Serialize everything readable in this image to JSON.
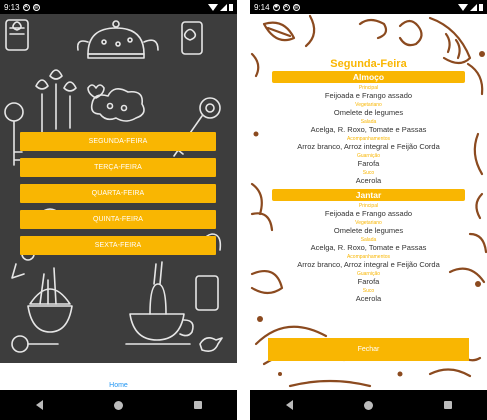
{
  "left_screen": {
    "status": {
      "time": "9:13",
      "icons": [
        "a-icon",
        "sync-icon"
      ]
    },
    "days": [
      "SEGUNDA-FEIRA",
      "TERÇA-FEIRA",
      "QUARTA-FEIRA",
      "QUINTA-FEIRA",
      "SEXTA-FEIRA"
    ],
    "bottom_tab": "Home"
  },
  "right_screen": {
    "status": {
      "time": "9:14"
    },
    "day_title": "Segunda-Feira",
    "lunch": {
      "title": "Almoço",
      "items": [
        {
          "label": "Principal",
          "value": "Feijoada e Frango assado"
        },
        {
          "label": "Vegetariano",
          "value": "Omelete de legumes"
        },
        {
          "label": "Salada",
          "value": "Acelga, R. Roxo, Tomate e Passas"
        },
        {
          "label": "Acompanhamentos",
          "value": "Arroz branco, Arroz integral e Feijão Corda"
        },
        {
          "label": "Guarnição",
          "value": "Farofa"
        },
        {
          "label": "Suco",
          "value": "Acerola"
        }
      ]
    },
    "dinner": {
      "title": "Jantar",
      "items": [
        {
          "label": "Principal",
          "value": "Feijoada e Frango assado"
        },
        {
          "label": "Vegetariano",
          "value": "Omelete de legumes"
        },
        {
          "label": "Salada",
          "value": "Acelga, R. Roxo, Tomate e Passas"
        },
        {
          "label": "Acompanhamentos",
          "value": "Arroz branco, Arroz integral e Feijão Corda"
        },
        {
          "label": "Guarnição",
          "value": "Farofa"
        },
        {
          "label": "Suco",
          "value": "Acerola"
        }
      ]
    },
    "close_label": "Fechar"
  },
  "colors": {
    "accent": "#f9b602",
    "doodle_bg": "#3d3d3d",
    "tab_blue": "#2196f3",
    "doodle_brown": "#8b4a1f"
  }
}
